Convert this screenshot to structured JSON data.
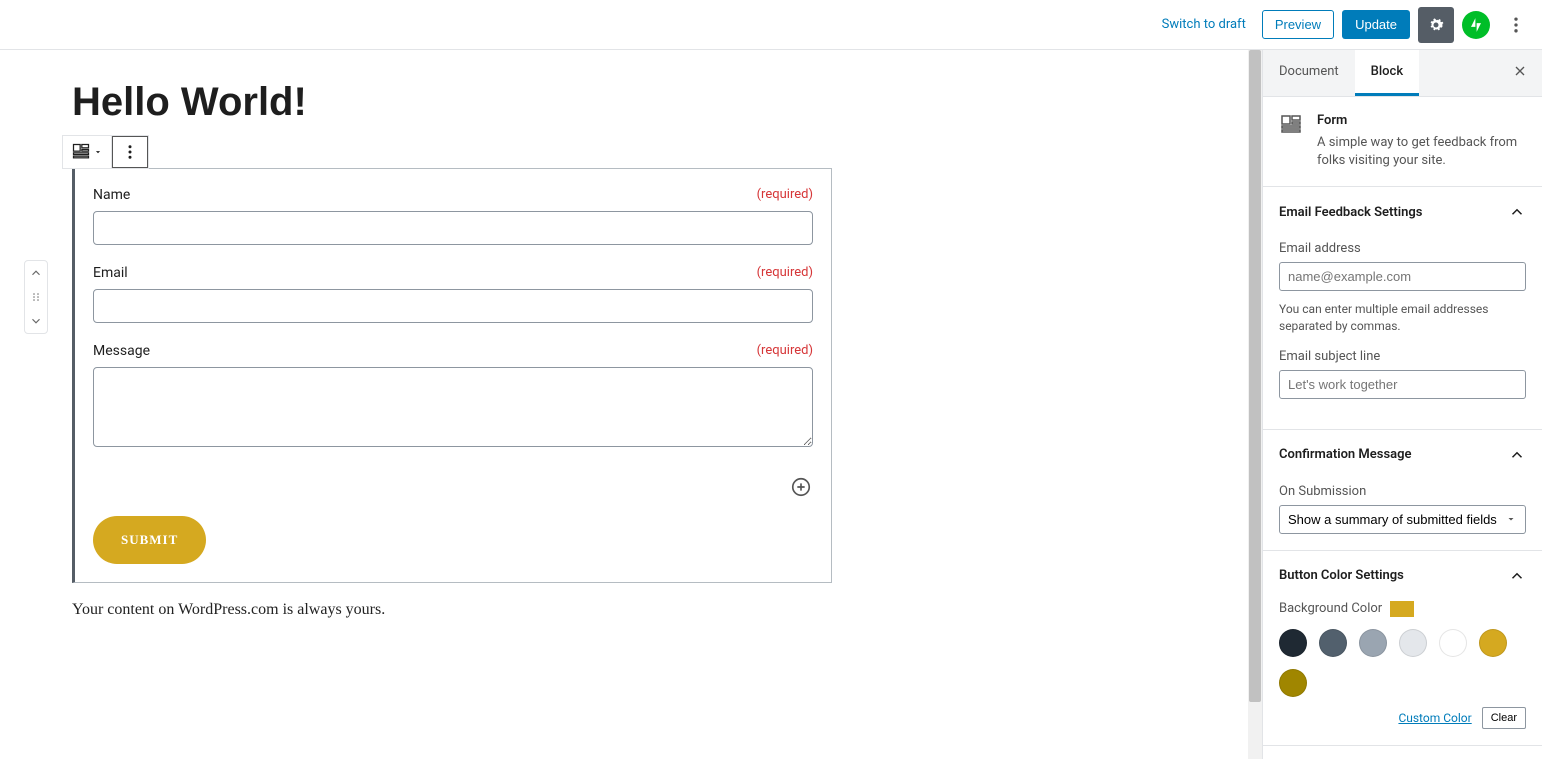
{
  "topbar": {
    "switch_to_draft": "Switch to draft",
    "preview": "Preview",
    "update": "Update"
  },
  "editor": {
    "title": "Hello World!",
    "form": {
      "fields": [
        {
          "label": "Name",
          "required": "(required)",
          "type": "text"
        },
        {
          "label": "Email",
          "required": "(required)",
          "type": "text"
        },
        {
          "label": "Message",
          "required": "(required)",
          "type": "textarea"
        }
      ],
      "submit": "SUBMIT"
    },
    "footer_note": "Your content on WordPress.com is always yours."
  },
  "sidebar": {
    "tabs": {
      "document": "Document",
      "block": "Block"
    },
    "block_info": {
      "title": "Form",
      "description": "A simple way to get feedback from folks visiting your site."
    },
    "panels": {
      "email": {
        "title": "Email Feedback Settings",
        "email_label": "Email address",
        "email_placeholder": "name@example.com",
        "email_help": "You can enter multiple email addresses separated by commas.",
        "subject_label": "Email subject line",
        "subject_placeholder": "Let's work together"
      },
      "confirmation": {
        "title": "Confirmation Message",
        "on_submission_label": "On Submission",
        "selected": "Show a summary of submitted fields"
      },
      "button_color": {
        "title": "Button Color Settings",
        "bg_label": "Background Color",
        "current": "#d5a920",
        "palette": [
          "#1f2933",
          "#52606d",
          "#9aa5b1",
          "#e4e7eb",
          "#ffffff",
          "#d5a920",
          "#a08600"
        ],
        "custom_color": "Custom Color",
        "clear": "Clear"
      }
    }
  }
}
